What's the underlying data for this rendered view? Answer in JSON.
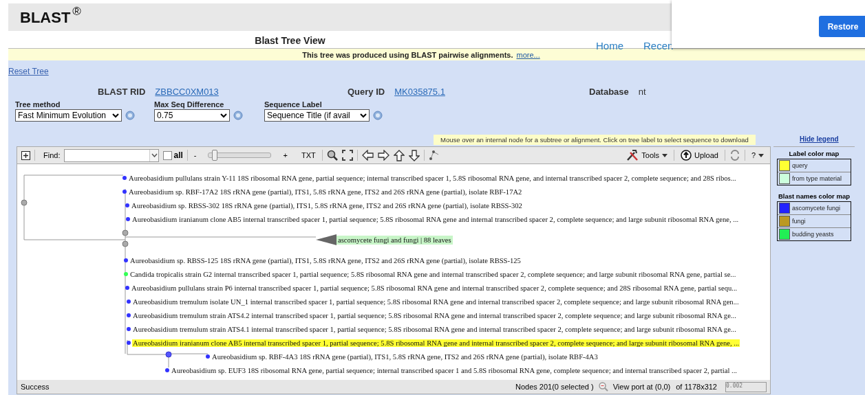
{
  "header": {
    "logo": "BLAST",
    "mark": "®"
  },
  "page_title": "Blast Tree View",
  "nav": [
    "Home",
    "Recen"
  ],
  "popup": {
    "button": "Restore"
  },
  "banner": {
    "text": "This tree was produced using BLAST pairwise alignments.",
    "link": "more..."
  },
  "reset_link": "Reset Tree",
  "info": [
    {
      "label": "BLAST RID",
      "value": "ZBBCC0XM013",
      "kind": "link"
    },
    {
      "label": "Query ID",
      "value": "MK035875.1",
      "kind": "link"
    },
    {
      "label": "Database",
      "value": "nt",
      "kind": "text"
    }
  ],
  "options": [
    {
      "label": "Tree method",
      "value": "Fast Minimum Evolution"
    },
    {
      "label": "Max Seq Difference",
      "value": "0.75"
    },
    {
      "label": "Sequence Label",
      "value": "Sequence Title (if avail"
    }
  ],
  "hint": "Mouse over an internal node for a subtree or alignment. Click on tree label to select sequence to download",
  "toolbar": {
    "find_label": "Find:",
    "all_label": "all",
    "all_checked": false,
    "minus": "-",
    "plus": "+",
    "level": 0.05,
    "txt": "TXT",
    "tools": "Tools",
    "upload": "Upload",
    "help": "?"
  },
  "tree": {
    "leaves": [
      {
        "kind": "leaf",
        "label": "Aureobasidium pullulans strain Y-11 18S ribosomal RNA gene, partial sequence; internal transcribed spacer 1, 5.8S ribosomal RNA gene, and internal transcribed spacer 2, complete sequence; and 28S ribos...",
        "color": "#3333ff",
        "query": false
      },
      {
        "kind": "leaf",
        "label": "Aureobasidium sp. RBF-17A2 18S rRNA gene (partial), ITS1, 5.8S rRNA gene, ITS2 and 26S rRNA gene (partial), isolate RBF-17A2",
        "color": "#3333ff",
        "query": false
      },
      {
        "kind": "leaf",
        "label": "Aureobasidium sp. RBSS-302 18S rRNA gene (partial), ITS1, 5.8S rRNA gene, ITS2 and 26S rRNA gene (partial), isolate RBSS-302",
        "color": "#3333ff",
        "query": false
      },
      {
        "kind": "leaf",
        "label": "Aureobasidium iranianum clone AB5 internal transcribed spacer 1, partial sequence; 5.8S ribosomal RNA gene and internal transcribed spacer 2, complete sequence; and large subunit ribosomal RNA gene, ...",
        "color": "#3333ff",
        "query": false
      },
      {
        "kind": "collapsed",
        "label": "ascomycete fungi and fungi | 88 leaves",
        "color": "#c8f5c8"
      },
      {
        "kind": "leaf",
        "label": "Aureobasidium sp. RBSS-125 18S rRNA gene (partial), ITS1, 5.8S rRNA gene, ITS2 and 26S rRNA gene (partial), isolate RBSS-125",
        "color": "#3333ff",
        "query": false
      },
      {
        "kind": "leaf",
        "label": "Candida tropicalis strain G2 internal transcribed spacer 1, partial sequence; 5.8S ribosomal RNA gene and internal transcribed spacer 2, complete sequence; and large subunit ribosomal RNA gene, partial se...",
        "color": "#33ff55",
        "query": false
      },
      {
        "kind": "leaf",
        "label": "Aureobasidium pullulans strain P6 internal transcribed spacer 1, partial sequence; 5.8S ribosomal RNA gene and internal transcribed spacer 2, complete sequence; and 28S ribosomal RNA gene, partial sequ...",
        "color": "#3333ff",
        "query": false
      },
      {
        "kind": "leaf",
        "label": "Aureobasidium tremulum isolate UN_1 internal transcribed spacer 1, partial sequence; 5.8S ribosomal RNA gene and internal transcribed spacer 2, complete sequence; and large subunit ribosomal RNA gen...",
        "color": "#3333ff",
        "query": false
      },
      {
        "kind": "leaf",
        "label": "Aureobasidium tremulum strain ATS4.2 internal transcribed spacer 1, partial sequence; 5.8S ribosomal RNA gene and internal transcribed spacer 2, complete sequence; and large subunit ribosomal RNA ge...",
        "color": "#3333ff",
        "query": false
      },
      {
        "kind": "leaf",
        "label": "Aureobasidium tremulum strain ATS4.1 internal transcribed spacer 1, partial sequence; 5.8S ribosomal RNA gene and internal transcribed spacer 2, complete sequence; and large subunit ribosomal RNA ge...",
        "color": "#3333ff",
        "query": false
      },
      {
        "kind": "leaf",
        "label": "Aureobasidium iranianum clone AB5 internal transcribed spacer 1, partial sequence; 5.8S ribosomal RNA gene and internal transcribed spacer 2, complete sequence; and large subunit ribosomal RNA gene, ...",
        "color": "#3333ff",
        "query": true
      },
      {
        "kind": "leaf",
        "label": "Aureobasidium sp. RBF-4A3 18S rRNA gene (partial), ITS1, 5.8S rRNA gene, ITS2 and 26S rRNA gene (partial), isolate RBF-4A3",
        "color": "#3333ff",
        "query": false
      },
      {
        "kind": "leaf",
        "label": "Aureobasidium sp. EUF3 18S ribosomal RNA gene, partial sequence; internal transcribed spacer 1 and 5.8S ribosomal RNA gene, complete sequence; and internal transcribed spacer 2, partial ...",
        "color": "#3333ff",
        "query": false
      }
    ]
  },
  "status": {
    "text": "Success",
    "nodes": "Nodes 201(0 selected )",
    "viewport": "View port at (0,0)",
    "size": "of 1178x312",
    "scale": "0.002"
  },
  "legend": {
    "hide_link": "Hide legend",
    "maps": [
      {
        "title": "Label color map",
        "items": [
          {
            "label": "query",
            "color": "#ffff33"
          },
          {
            "label": "from type material",
            "color": "#ccffdd"
          }
        ]
      },
      {
        "title": "Blast names color map",
        "items": [
          {
            "label": "ascomycete fungi",
            "color": "#2222ff"
          },
          {
            "label": "fungi",
            "color": "#bb9922"
          },
          {
            "label": "budding yeasts",
            "color": "#22ee55"
          }
        ]
      }
    ]
  }
}
